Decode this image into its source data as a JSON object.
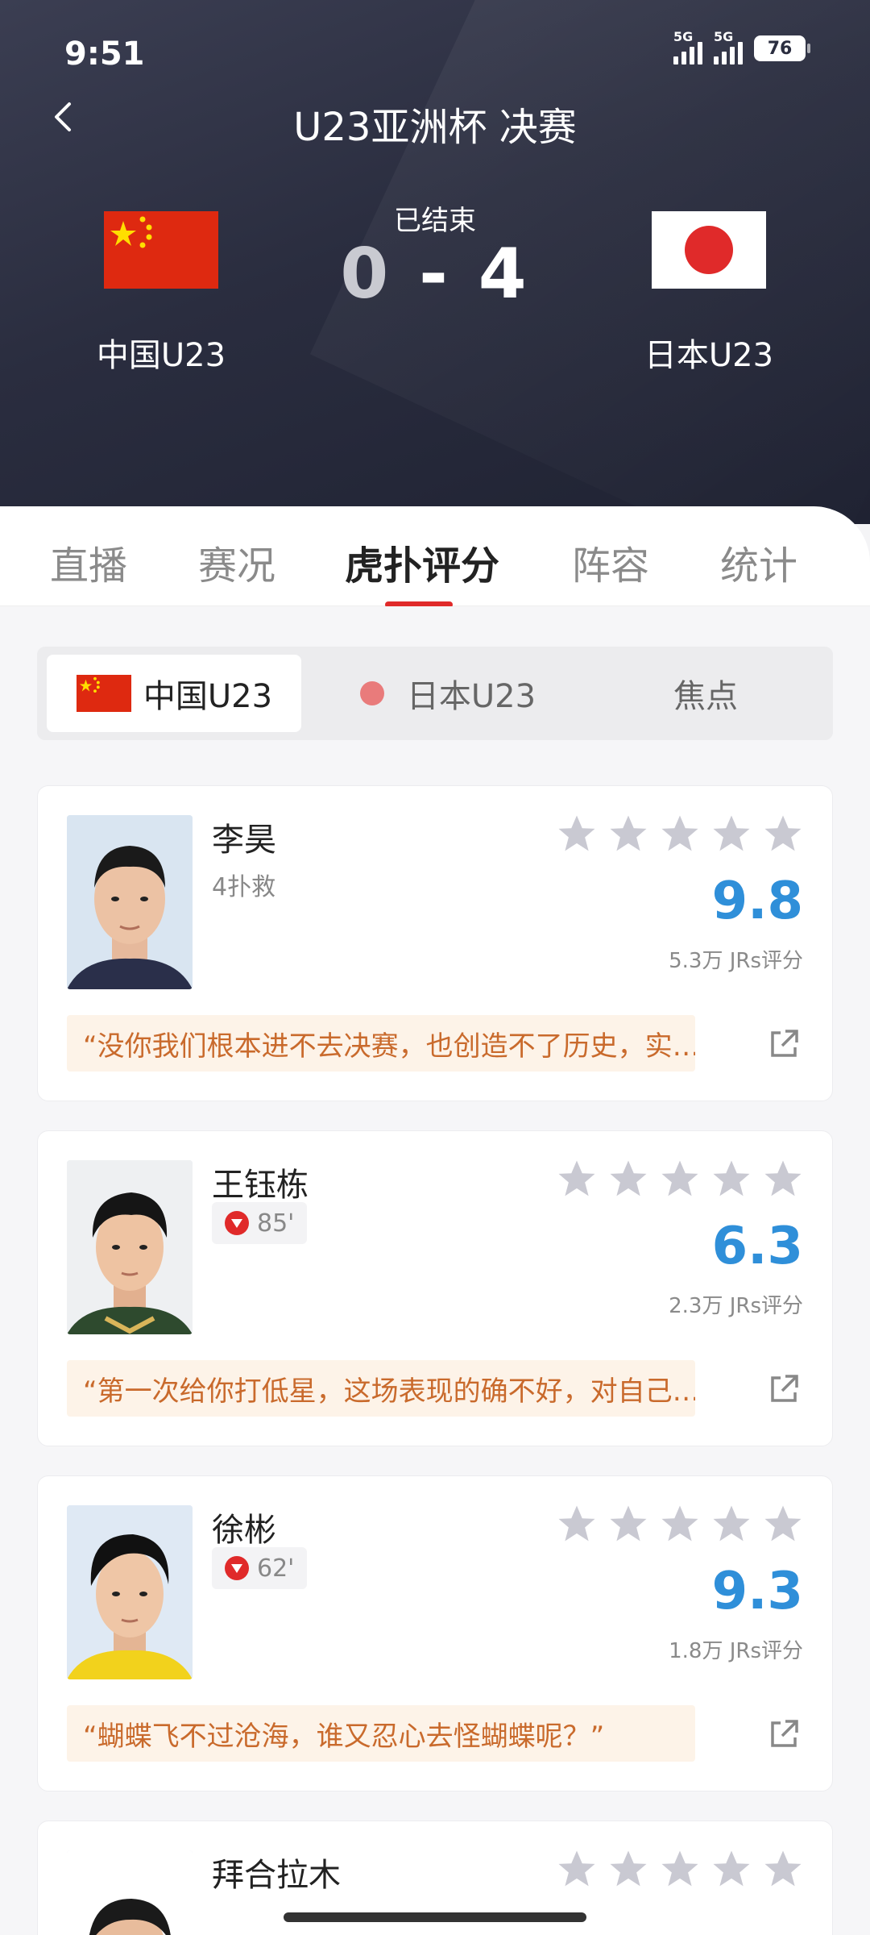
{
  "status_bar": {
    "time": "9:51",
    "signal1": "5G",
    "signal2": "5G",
    "battery": "76"
  },
  "header": {
    "title": "U23亚洲杯 决赛",
    "status": "已结束",
    "home_score": "0",
    "separator": "-",
    "away_score": "4",
    "home_team": "中国U23",
    "away_team": "日本U23"
  },
  "tabs": [
    "直播",
    "赛况",
    "虎扑评分",
    "阵容",
    "统计"
  ],
  "active_tab": "虎扑评分",
  "segment": {
    "home": "中国U23",
    "away": "日本U23",
    "focus": "焦点"
  },
  "players": [
    {
      "name": "李昊",
      "sub": "4扑救",
      "rating": "9.8",
      "votes": "5.3万 JRs评分",
      "comment": "“没你我们根本进不去决赛，也创造不了历史，实…"
    },
    {
      "name": "王钰栋",
      "sub": "85'",
      "rating": "6.3",
      "votes": "2.3万 JRs评分",
      "comment": "“第一次给你打低星，这场表现的确不好，对自己…"
    },
    {
      "name": "徐彬",
      "sub": "62'",
      "rating": "9.3",
      "votes": "1.8万 JRs评分",
      "comment": "“蝴蝶飞不过沧海，谁又忍心去怪蝴蝶呢？”"
    },
    {
      "name": "拜合拉木"
    }
  ],
  "icons": {
    "back": "chevron-left-icon",
    "star": "star-icon",
    "share": "share-icon",
    "sub_off": "substitution-off-icon"
  },
  "colors": {
    "accent": "#e02a2a",
    "rating": "#2f8fd9",
    "comment_text": "#c96a2c"
  }
}
